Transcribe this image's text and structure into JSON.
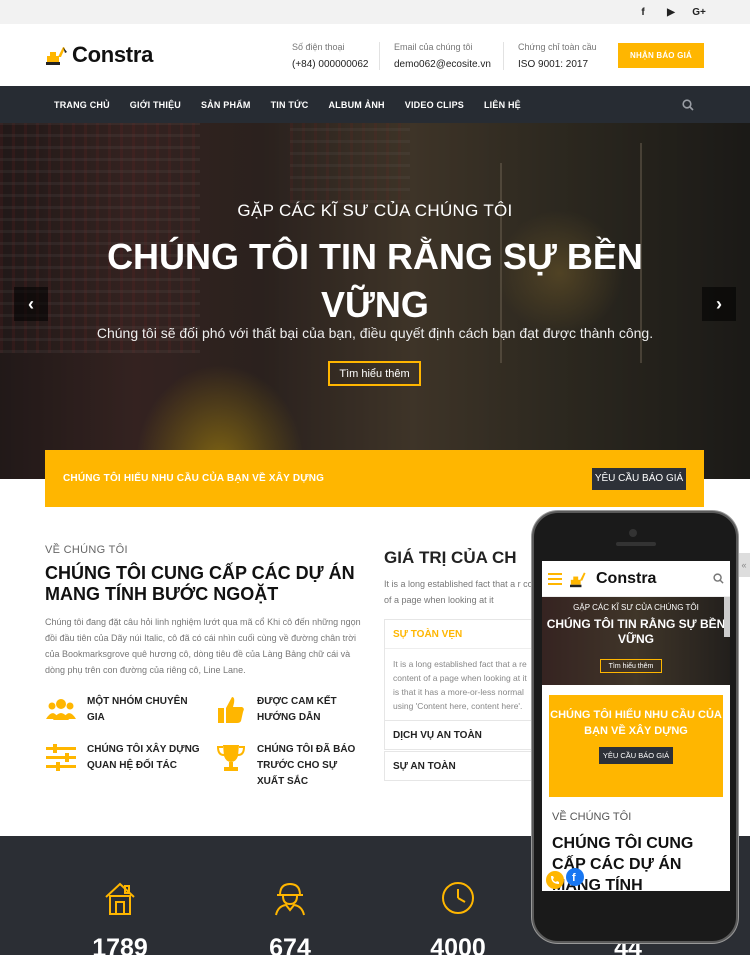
{
  "topbar": {
    "social": [
      "f",
      "▶",
      "G+"
    ]
  },
  "header": {
    "logo": "Constra",
    "phone_label": "Số điện thoại",
    "phone_value": "(+84) 000000062",
    "email_label": "Email của chúng tôi",
    "email_value": "demo062@ecosite.vn",
    "cert_label": "Chứng chỉ toàn cầu",
    "cert_value": "ISO 9001: 2017",
    "quote_button": "NHẬN BÁO GIÁ"
  },
  "nav": {
    "items": [
      "TRANG CHỦ",
      "GIỚI THIỆU",
      "SẢN PHẨM",
      "TIN TỨC",
      "ALBUM ẢNH",
      "VIDEO CLIPS",
      "LIÊN HỆ"
    ]
  },
  "hero": {
    "subtitle": "GẶP CÁC KĨ SƯ CỦA CHÚNG TÔI",
    "title": "CHÚNG TÔI TIN RẰNG SỰ BỀN VỮNG",
    "description": "Chúng tôi sẽ đối phó với thất bại của bạn, điều quyết định cách bạn đạt được thành công.",
    "button": "Tìm hiểu thêm",
    "prev": "‹",
    "next": "›"
  },
  "banner": {
    "text": "CHÚNG TÔI HIỂU NHU CẦU CỦA BẠN VỀ XÂY DỰNG",
    "button": "YÊU CẦU BÁO GIÁ"
  },
  "about": {
    "small": "VỀ CHÚNG TÔI",
    "title": "CHÚNG TÔI CUNG CẤP CÁC DỰ ÁN MANG TÍNH BƯỚC NGOẶT",
    "text": "Chúng tôi đang đặt câu hỏi linh nghiệm lướt qua mã cổ Khi cô đến những ngọn đồi đầu tiên của Dãy núi Italic, cô đã có cái nhìn cuối cùng về đường chân trời của Bookmarksgrove quê hương cô, dòng tiêu đề của Làng Bảng chữ cái và dòng phụ trên con đường của riêng cô, Line Lane.",
    "features": [
      "MỘT NHÓM CHUYÊN GIA",
      "ĐƯỢC CAM KẾT HƯỚNG DẪN",
      "CHÚNG TÔI XÂY DỰNG QUAN HỆ ĐỐI TÁC",
      "CHÚNG TÔI ĐÃ BÁO TRƯỚC CHO SỰ XUẤT SẮC"
    ]
  },
  "values": {
    "title": "GIÁ TRỊ CỦA CH",
    "text": "It is a long established fact that a r content of a page when looking at it",
    "acc1_title": "SỰ TOÀN VẸN",
    "acc1_body": "It is a long established fact that a re content of a page when looking at it is that it has a more-or-less normal using 'Content here, content here'.",
    "acc2_title": "DỊCH VỤ AN TOÀN",
    "acc3_title": "SỰ AN TOÀN"
  },
  "stats": {
    "numbers": [
      "1789",
      "674",
      "4000",
      "44"
    ]
  },
  "phone": {
    "logo": "Constra",
    "hero_sub": "GẶP CÁC KĨ SƯ CỦA CHÚNG TÔI",
    "hero_title": "CHÚNG TÔI TIN RẰNG SỰ BỀN VỮNG",
    "hero_button": "Tìm hiểu thêm",
    "banner_text": "CHÚNG TÔI HIỂU NHU CẦU CỦA BẠN VỀ XÂY DỰNG",
    "banner_button": "YÊU CẦU BÁO GIÁ",
    "about_small": "VỀ CHÚNG TÔI",
    "about_title": "CHÚNG TÔI CUNG CẤP CÁC DỰ ÁN MANG TÍNH"
  },
  "colors": {
    "accent": "#ffb600",
    "dark": "#272c33"
  }
}
